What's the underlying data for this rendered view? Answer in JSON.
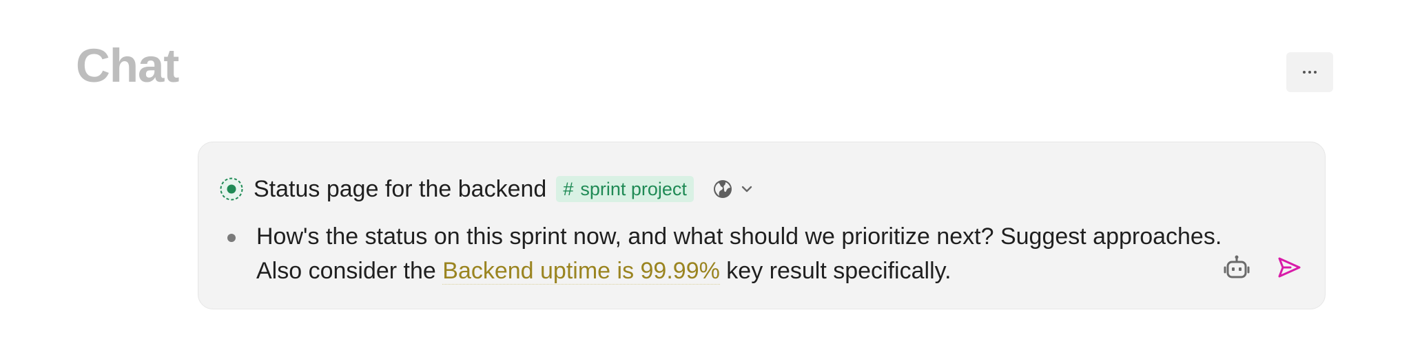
{
  "header": {
    "title": "Chat",
    "more_icon": "more-horizontal-icon"
  },
  "chat": {
    "project": {
      "status_icon": "in-progress-status-icon",
      "title": "Status page for the backend",
      "tag_symbol": "#",
      "tag_label": "sprint project",
      "visibility_icon": "globe-icon",
      "dropdown_icon": "chevron-down-icon"
    },
    "message": {
      "text_before": "How's the status on this sprint now, and what should we prioritize next? Suggest approaches. Also consider the ",
      "key_result": "Backend uptime is 99.99%",
      "text_after": " key result specifically."
    },
    "actions": {
      "agent_icon": "robot-icon",
      "send_icon": "send-icon"
    }
  },
  "colors": {
    "title_gray": "#bdbdbd",
    "card_background": "#f3f3f3",
    "status_green": "#1f8a55",
    "tag_background": "#d9f1e4",
    "key_result_gold": "#9a8420",
    "send_magenta": "#d81ba8"
  }
}
